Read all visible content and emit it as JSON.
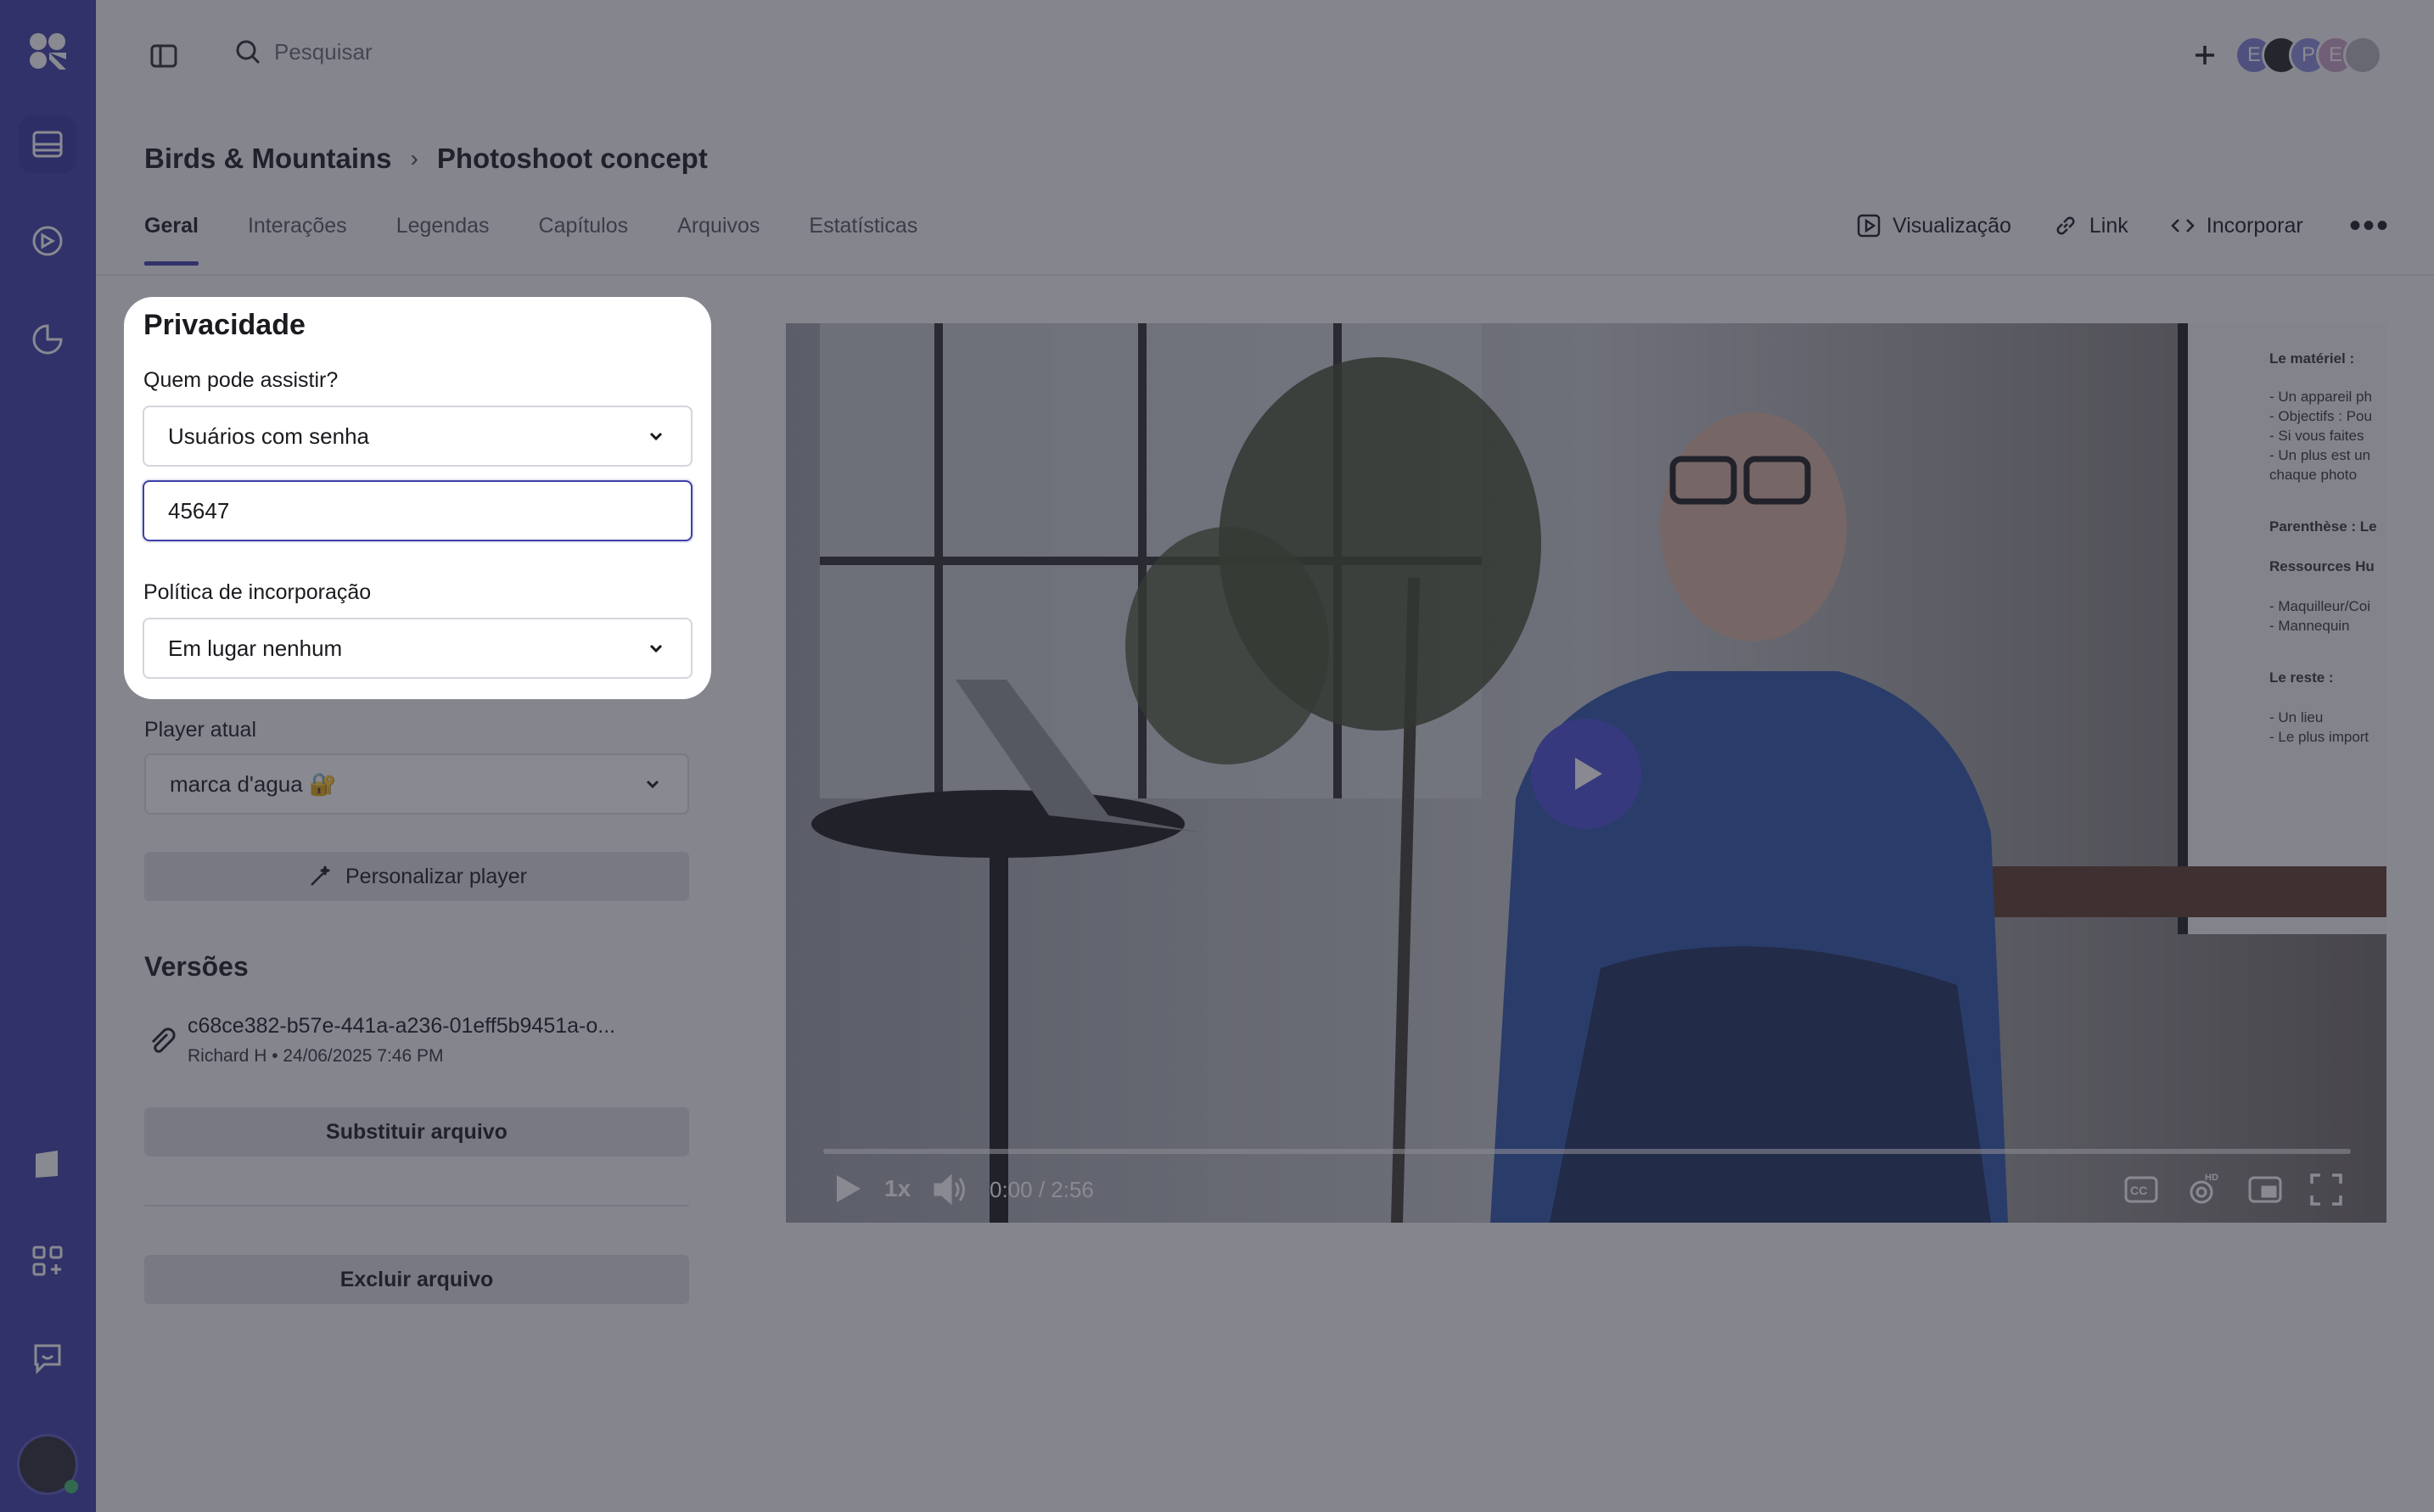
{
  "topbar": {
    "search_placeholder": "Pesquisar",
    "avatars": [
      "E",
      "",
      "P",
      "E",
      ""
    ]
  },
  "breadcrumb": {
    "folder": "Birds & Mountains",
    "separator": "›",
    "video": "Photoshoot concept"
  },
  "tabs": [
    {
      "label": "Geral",
      "active": true
    },
    {
      "label": "Interações",
      "active": false
    },
    {
      "label": "Legendas",
      "active": false
    },
    {
      "label": "Capítulos",
      "active": false
    },
    {
      "label": "Arquivos",
      "active": false
    },
    {
      "label": "Estatísticas",
      "active": false
    }
  ],
  "actions": {
    "preview": "Visualização",
    "link": "Link",
    "embed": "Incorporar"
  },
  "privacy": {
    "title": "Privacidade",
    "who_label": "Quem pode assistir?",
    "who_value": "Usuários com senha",
    "password_value": "45647",
    "embed_label": "Política de incorporação",
    "embed_value": "Em lugar nenhum"
  },
  "player": {
    "label": "Player atual",
    "value": "marca d'agua 🔐",
    "customize": "Personalizar player"
  },
  "versions": {
    "title": "Versões",
    "file_name": "c68ce382-b57e-441a-a236-01eff5b9451a-o...",
    "file_meta": "Richard H • 24/06/2025 7:46 PM",
    "replace": "Substituir arquivo",
    "delete": "Excluir arquivo"
  },
  "video": {
    "speed": "1x",
    "time": "0:00 / 2:56",
    "progress": 0,
    "whiteboard": [
      "Le matériel :",
      "- Un appareil ph",
      "- Objectifs : Pou",
      "- Si vous faites",
      "- Un plus est un",
      "chaque photo",
      "Parenthèse : Le",
      "Ressources Hu",
      "- Maquilleur/Coi",
      "- Mannequin",
      "Le reste :",
      "- Un lieu",
      "- Le plus import"
    ]
  },
  "colors": {
    "accent": "#3d3fa6",
    "overlay": "rgba(40,40,55,0.55)"
  }
}
